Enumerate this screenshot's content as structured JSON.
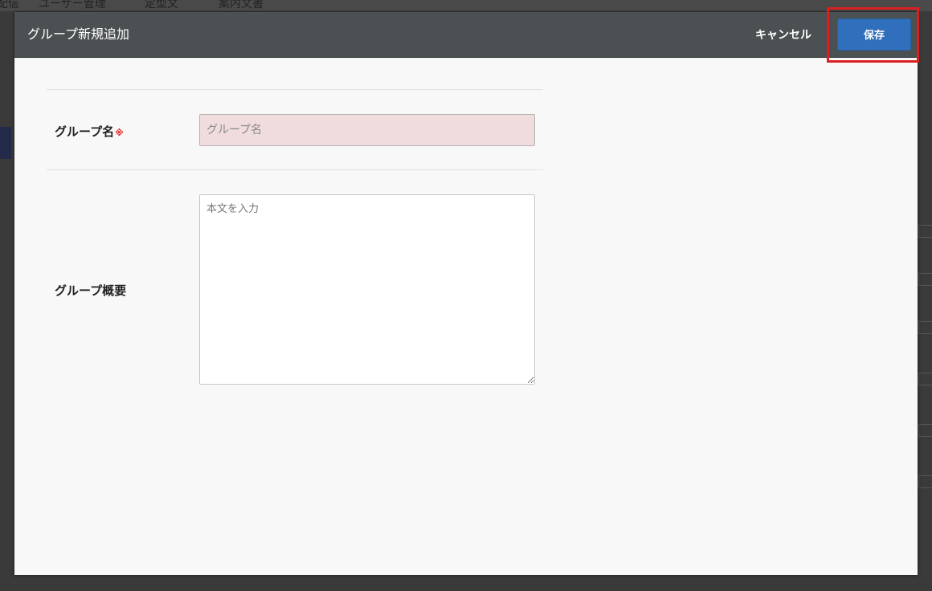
{
  "background": {
    "nav_items": [
      "配信",
      "ユーザー管理",
      "定型文",
      "案内文書"
    ]
  },
  "modal": {
    "title": "グループ新規追加",
    "cancel_label": "キャンセル",
    "save_label": "保存",
    "fields": {
      "group_name": {
        "label": "グループ名",
        "required_mark": "※",
        "placeholder": "グループ名",
        "value": ""
      },
      "group_description": {
        "label": "グループ概要",
        "placeholder": "本文を入力",
        "value": ""
      }
    }
  },
  "colors": {
    "header_bg": "#4b5052",
    "save_button": "#2f6fbb",
    "highlight": "#d91f1f",
    "required_input_bg": "#f0dcdc",
    "required_mark": "#e02020"
  }
}
